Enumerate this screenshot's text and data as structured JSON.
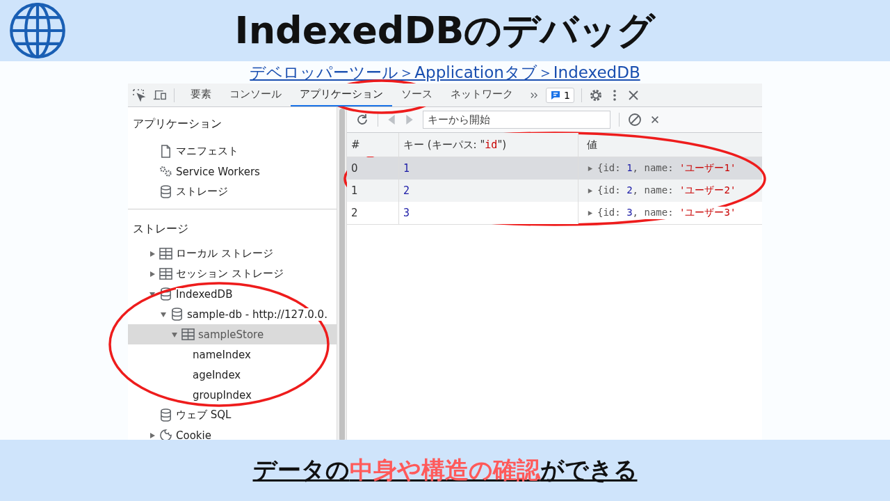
{
  "header": {
    "title": "IndexedDBのデバッグ"
  },
  "breadcrumb": "デベロッパーツール＞Applicationタブ＞IndexedDB",
  "devtools": {
    "tabs": [
      {
        "label": "要素",
        "selected": false
      },
      {
        "label": "コンソール",
        "selected": false
      },
      {
        "label": "アプリケーション",
        "selected": true
      },
      {
        "label": "ソース",
        "selected": false
      },
      {
        "label": "ネットワーク",
        "selected": false
      }
    ],
    "issues_badge": "1",
    "sidebar": {
      "sections": [
        {
          "title": "アプリケーション",
          "items": [
            {
              "label": "マニフェスト",
              "kind": "file",
              "selected": false
            },
            {
              "label": "Service Workers",
              "kind": "gears",
              "selected": false
            },
            {
              "label": "ストレージ",
              "kind": "database",
              "selected": false
            }
          ]
        },
        {
          "title": "ストレージ",
          "items": [
            {
              "label": "ローカル ストレージ",
              "kind": "table",
              "selected": false,
              "expanded": false
            },
            {
              "label": "セッション ストレージ",
              "kind": "table",
              "selected": false,
              "expanded": false
            },
            {
              "label": "IndexedDB",
              "kind": "database",
              "selected": false,
              "expanded": true,
              "children": [
                {
                  "label": "sample-db - http://127.0.0.",
                  "kind": "database",
                  "selected": false,
                  "expanded": true,
                  "children": [
                    {
                      "label": "sampleStore",
                      "kind": "table",
                      "selected": true,
                      "expanded": true,
                      "children": [
                        {
                          "label": "nameIndex",
                          "selected": false
                        },
                        {
                          "label": "ageIndex",
                          "selected": false
                        },
                        {
                          "label": "groupIndex",
                          "selected": false
                        }
                      ]
                    }
                  ]
                }
              ]
            },
            {
              "label": "ウェブ SQL",
              "kind": "database",
              "selected": false
            },
            {
              "label": "Cookie",
              "kind": "cookie",
              "selected": false,
              "expanded": false
            }
          ]
        }
      ]
    },
    "key_search": {
      "placeholder": "キーから開始"
    },
    "table": {
      "index_header": "#",
      "key_header": {
        "prefix": "キー (キーパス: \"",
        "keypath": "id",
        "suffix": "\")"
      },
      "value_header": "値",
      "rows": [
        {
          "index": "0",
          "key": "1",
          "selected": true,
          "value": [
            {
              "text": "{id: ",
              "kind": "plain"
            },
            {
              "text": "1",
              "kind": "number"
            },
            {
              "text": ", name: ",
              "kind": "plain"
            },
            {
              "text": "'ユーザー1'",
              "kind": "string"
            }
          ]
        },
        {
          "index": "1",
          "key": "2",
          "selected": false,
          "value": [
            {
              "text": "{id: ",
              "kind": "plain"
            },
            {
              "text": "2",
              "kind": "number"
            },
            {
              "text": ", name: ",
              "kind": "plain"
            },
            {
              "text": "'ユーザー2'",
              "kind": "string"
            }
          ]
        },
        {
          "index": "2",
          "key": "3",
          "selected": false,
          "value": [
            {
              "text": "{id: ",
              "kind": "plain"
            },
            {
              "text": "3",
              "kind": "number"
            },
            {
              "text": ", name: ",
              "kind": "plain"
            },
            {
              "text": "'ユーザー3'",
              "kind": "string"
            }
          ]
        }
      ]
    }
  },
  "footer": {
    "segments": [
      {
        "text": "データの",
        "highlight": false
      },
      {
        "text": "中身や構造の確認",
        "highlight": true
      },
      {
        "text": "ができる",
        "highlight": false
      }
    ]
  }
}
